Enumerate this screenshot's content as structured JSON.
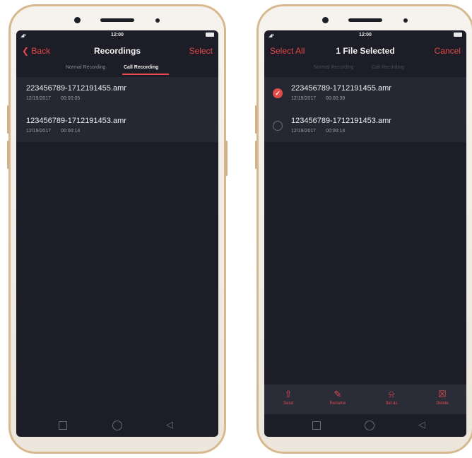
{
  "left_phone": {
    "status": {
      "time": "12:00",
      "signal": "◢•"
    },
    "title_bar": {
      "back": "❮ Back",
      "title": "Recordings",
      "action": "Select"
    },
    "tabs": [
      "Normal Recording",
      "Call Recording"
    ],
    "files": [
      {
        "name": "223456789-1712191455.amr",
        "date": "12/19/2017",
        "duration": "00:00:05"
      },
      {
        "name": "123456789-1712191453.amr",
        "date": "12/19/2017",
        "duration": "00:00:14"
      }
    ],
    "nav": {
      "recents_icon": "square-icon",
      "home_icon": "circle-icon",
      "back_icon": "◁"
    }
  },
  "right_phone": {
    "status": {
      "time": "12:00",
      "signal": "◢•"
    },
    "title_bar": {
      "select_all": "Select All",
      "title": "1 File Selected",
      "cancel": "Cancel"
    },
    "tabs": [
      "Normal Recording",
      "Call Recording"
    ],
    "files": [
      {
        "name": "223456789-1712191455.amr",
        "date": "12/19/2017",
        "duration": "00:00:39",
        "selected": true,
        "check_glyph": "✓"
      },
      {
        "name": "123456789-1712191453.amr",
        "date": "12/19/2017",
        "duration": "00:00:14",
        "selected": false
      }
    ],
    "actions": [
      {
        "icon": "⇧",
        "label": "Send"
      },
      {
        "icon": "✎",
        "label": "Rename"
      },
      {
        "icon": "⍾",
        "label": "Set as"
      },
      {
        "icon": "☒",
        "label": "Delete"
      }
    ],
    "nav": {
      "recents_icon": "square-icon",
      "home_icon": "circle-icon",
      "back_icon": "◁"
    }
  },
  "colors": {
    "accent": "#e24a4a",
    "screen_bg": "#1c1d26",
    "list_bg": "#252733",
    "frame_gold": "#d8b98f"
  }
}
